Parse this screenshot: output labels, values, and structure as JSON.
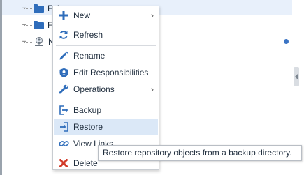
{
  "tree": {
    "rows": [
      {
        "label": "Fol"
      },
      {
        "label": "Fo"
      },
      {
        "label": "N"
      }
    ]
  },
  "context_menu": {
    "items": [
      {
        "label": "New",
        "icon": "plus-icon",
        "submenu": true
      },
      {
        "label": "Refresh",
        "icon": "refresh-icon",
        "submenu": false
      },
      {
        "label": "Rename",
        "icon": "pencil-icon",
        "submenu": false
      },
      {
        "label": "Edit Responsibilities",
        "icon": "user-shield-icon",
        "submenu": false
      },
      {
        "label": "Operations",
        "icon": "wrench-icon",
        "submenu": true
      },
      {
        "label": "Backup",
        "icon": "backup-icon",
        "submenu": false
      },
      {
        "label": "Restore",
        "icon": "restore-icon",
        "submenu": false,
        "highlighted": true
      },
      {
        "label": "View Links",
        "icon": "link-icon",
        "submenu": false
      },
      {
        "label": "Delete",
        "icon": "delete-x-icon",
        "submenu": false
      }
    ],
    "submenu_glyph": "›"
  },
  "tooltip": {
    "text": "Restore repository objects from a backup directory."
  },
  "colors": {
    "accent": "#2f6dbb",
    "delete": "#d23b2b",
    "highlight": "#dbe8f7"
  }
}
